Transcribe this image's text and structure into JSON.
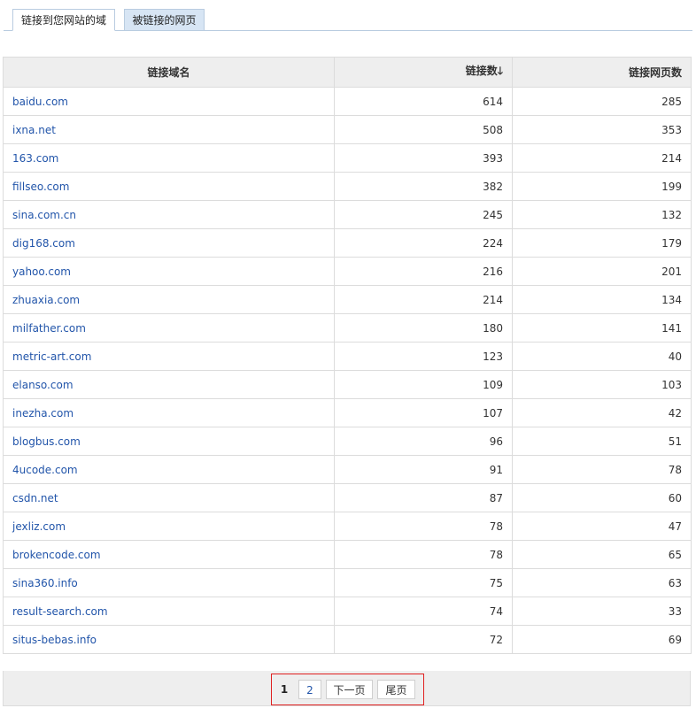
{
  "tabs": {
    "active": "链接到您网站的域",
    "inactive": "被链接的网页"
  },
  "table": {
    "headers": {
      "domain": "链接域名",
      "links": "链接数",
      "links_sort_icon": "arrow-down-icon",
      "pages": "链接网页数"
    },
    "rows": [
      {
        "domain": "baidu.com",
        "links": "614",
        "pages": "285"
      },
      {
        "domain": "ixna.net",
        "links": "508",
        "pages": "353"
      },
      {
        "domain": "163.com",
        "links": "393",
        "pages": "214"
      },
      {
        "domain": "fillseo.com",
        "links": "382",
        "pages": "199"
      },
      {
        "domain": "sina.com.cn",
        "links": "245",
        "pages": "132"
      },
      {
        "domain": "dig168.com",
        "links": "224",
        "pages": "179"
      },
      {
        "domain": "yahoo.com",
        "links": "216",
        "pages": "201"
      },
      {
        "domain": "zhuaxia.com",
        "links": "214",
        "pages": "134"
      },
      {
        "domain": "milfather.com",
        "links": "180",
        "pages": "141"
      },
      {
        "domain": "metric-art.com",
        "links": "123",
        "pages": "40"
      },
      {
        "domain": "elanso.com",
        "links": "109",
        "pages": "103"
      },
      {
        "domain": "inezha.com",
        "links": "107",
        "pages": "42"
      },
      {
        "domain": "blogbus.com",
        "links": "96",
        "pages": "51"
      },
      {
        "domain": "4ucode.com",
        "links": "91",
        "pages": "78"
      },
      {
        "domain": "csdn.net",
        "links": "87",
        "pages": "60"
      },
      {
        "domain": "jexliz.com",
        "links": "78",
        "pages": "47"
      },
      {
        "domain": "brokencode.com",
        "links": "78",
        "pages": "65"
      },
      {
        "domain": "sina360.info",
        "links": "75",
        "pages": "63"
      },
      {
        "domain": "result-search.com",
        "links": "74",
        "pages": "33"
      },
      {
        "domain": "situs-bebas.info",
        "links": "72",
        "pages": "69"
      }
    ]
  },
  "pager": {
    "current": "1",
    "page2": "2",
    "next": "下一页",
    "last": "尾页"
  },
  "colors": {
    "link": "#2255aa",
    "header_bg": "#eeeeee",
    "tab_inactive_bg": "#d7e5f4",
    "pager_highlight": "#e02020"
  }
}
